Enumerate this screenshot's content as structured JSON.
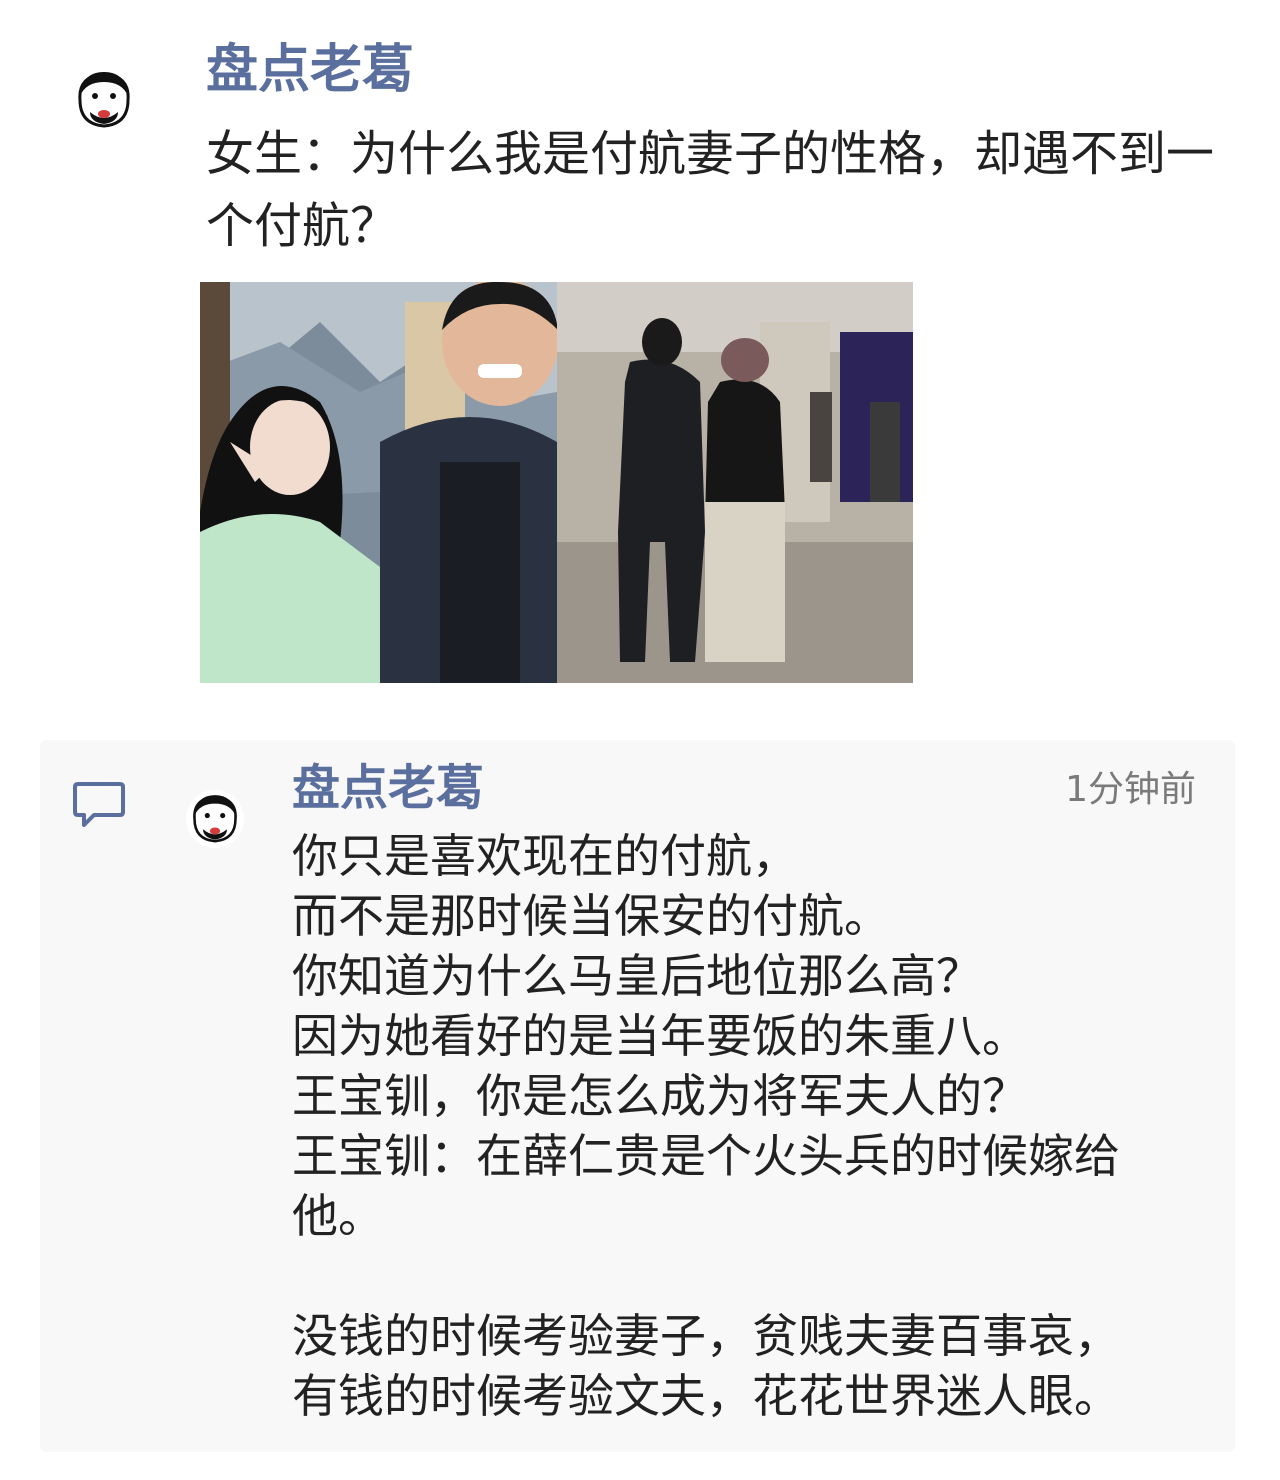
{
  "post": {
    "author": "盘点老葛",
    "text": "女生：为什么我是付航妻子的性格，却遇不到一个付航？",
    "avatar_icon": "cartoon-face-avatar",
    "image_panels": [
      "photo-selfie-couple",
      "photo-mall-walking"
    ]
  },
  "reply": {
    "icon": "comment-bubble-icon",
    "author": "盘点老葛",
    "time": "1分钟前",
    "avatar_icon": "cartoon-face-avatar",
    "lines": [
      "你只是喜欢现在的付航，",
      "而不是那时候当保安的付航。",
      "你知道为什么马皇后地位那么高？",
      "因为她看好的是当年要饭的朱重八。",
      "王宝钏，你是怎么成为将军夫人的？",
      "王宝钏：在薛仁贵是个火头兵的时候嫁给",
      "他。",
      "没钱的时候考验妻子，贫贱夫妻百事哀，",
      "有钱的时候考验文夫，花花世界迷人眼。"
    ]
  },
  "colors": {
    "author": "#5a6f9e",
    "text": "#222222",
    "time": "#7a7a7a",
    "card_bg": "#f8f8f9"
  }
}
